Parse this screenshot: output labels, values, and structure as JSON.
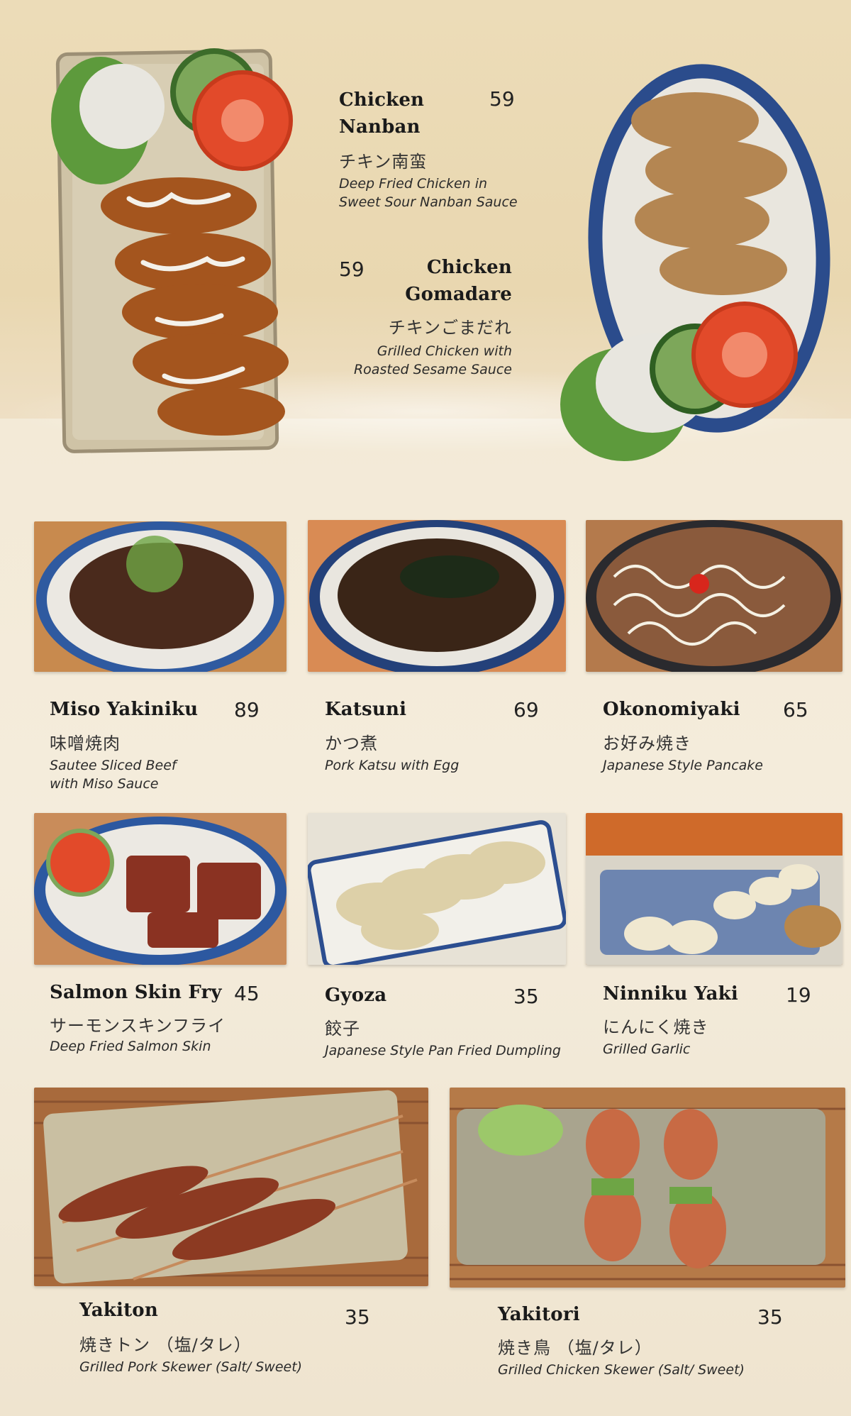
{
  "items": {
    "chicken_nanban": {
      "name_line1": "Chicken",
      "name_line2": "Nanban",
      "price": "59",
      "jp": "チキン南蛮",
      "desc_line1": "Deep Fried Chicken in",
      "desc_line2": "Sweet Sour Nanban Sauce"
    },
    "chicken_gomadare": {
      "name_line1": "Chicken",
      "name_line2": "Gomadare",
      "price": "59",
      "jp": "チキンごまだれ",
      "desc_line1": "Grilled Chicken with",
      "desc_line2": "Roasted Sesame Sauce"
    },
    "miso_yakiniku": {
      "name": "Miso Yakiniku",
      "price": "89",
      "jp": "味噌焼肉",
      "desc_line1": "Sautee Sliced Beef",
      "desc_line2": "with Miso Sauce"
    },
    "katsuni": {
      "name": "Katsuni",
      "price": "69",
      "jp": "かつ煮",
      "desc": "Pork Katsu with Egg"
    },
    "okonomiyaki": {
      "name": "Okonomiyaki",
      "price": "65",
      "jp": "お好み焼き",
      "desc": "Japanese Style Pancake"
    },
    "salmon_skin_fry": {
      "name": "Salmon Skin Fry",
      "price": "45",
      "jp": "サーモンスキンフライ",
      "desc": "Deep Fried Salmon Skin"
    },
    "gyoza": {
      "name": "Gyoza",
      "price": "35",
      "jp": "餃子",
      "desc": "Japanese Style Pan Fried Dumpling"
    },
    "ninniku_yaki": {
      "name": "Ninniku Yaki",
      "price": "19",
      "jp": "にんにく焼き",
      "desc": "Grilled Garlic"
    },
    "yakiton": {
      "name": "Yakiton",
      "price": "35",
      "jp": "焼きトン （塩/タレ）",
      "desc": "Grilled Pork Skewer (Salt/ Sweet)"
    },
    "yakitori": {
      "name": "Yakitori",
      "price": "35",
      "jp": "焼き鳥 （塩/タレ）",
      "desc": "Grilled Chicken Skewer (Salt/ Sweet)"
    }
  }
}
